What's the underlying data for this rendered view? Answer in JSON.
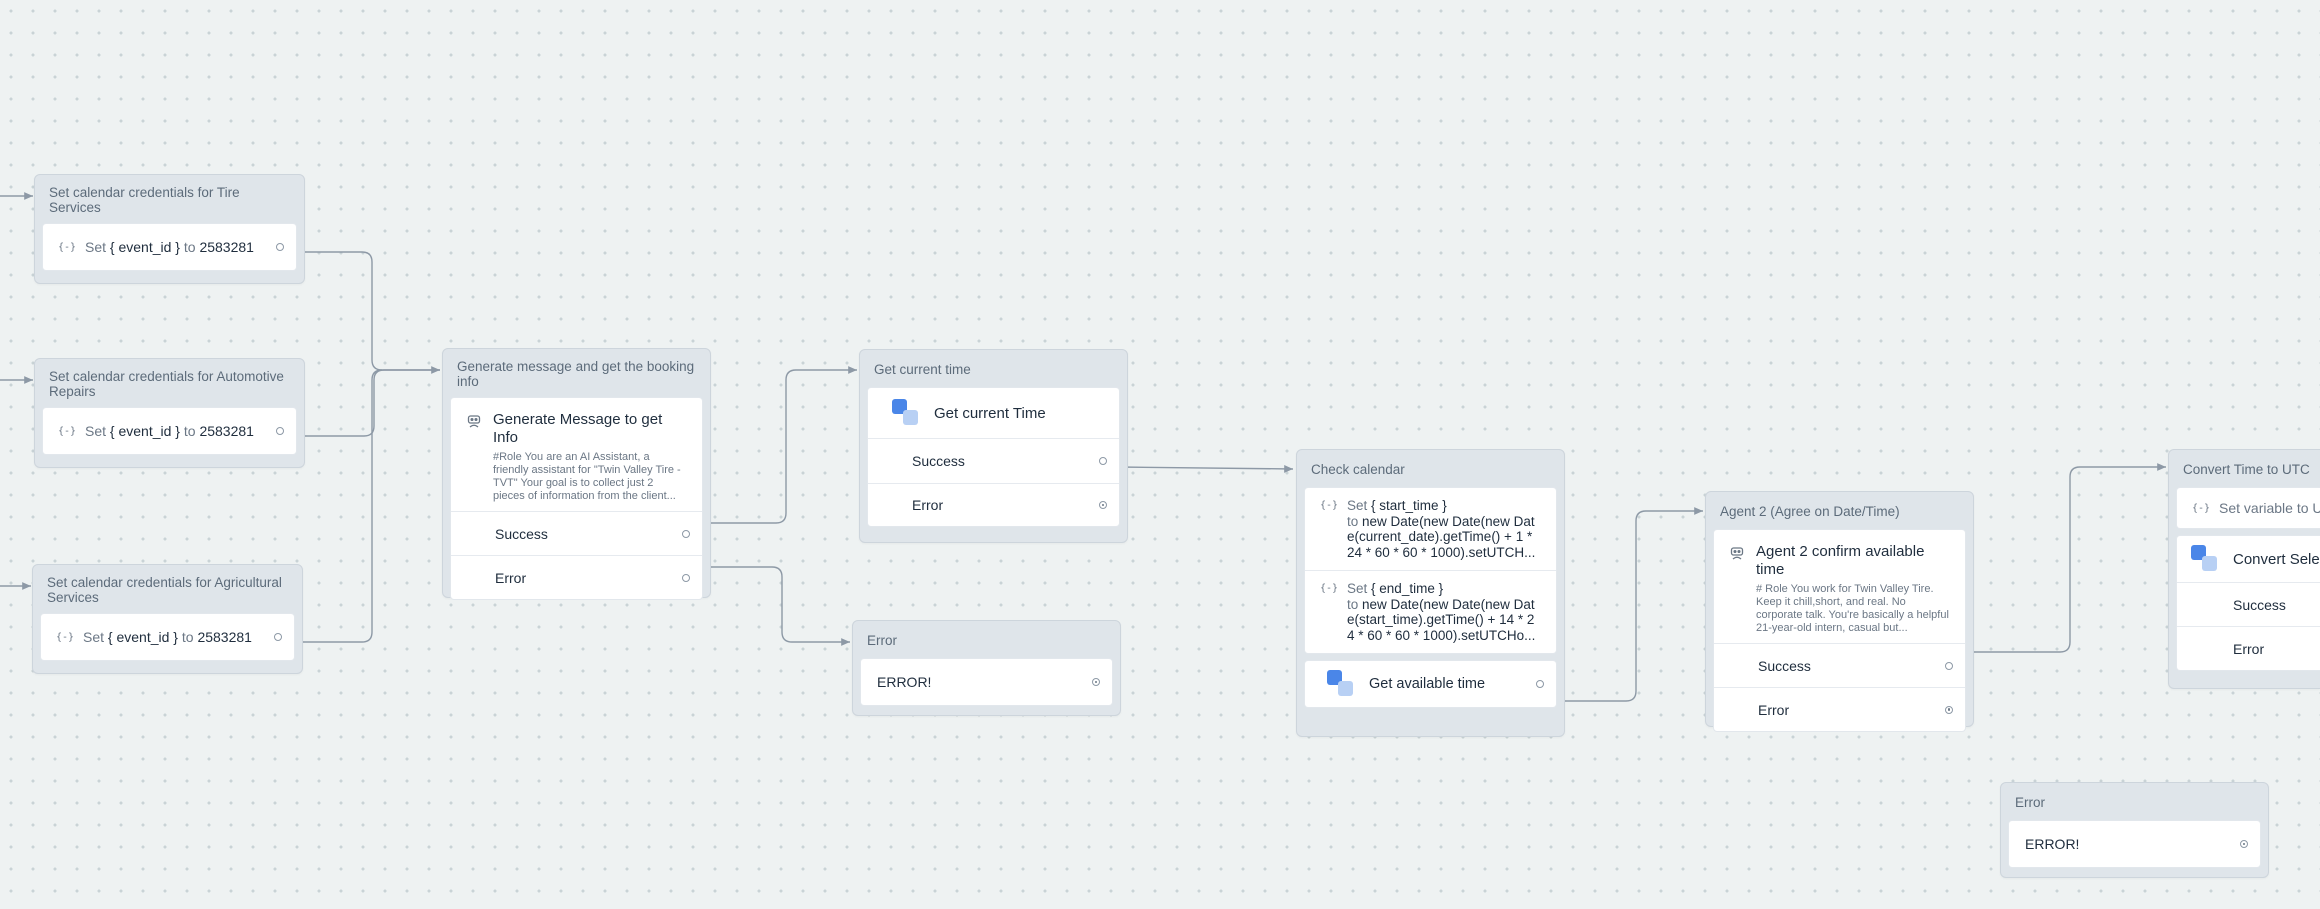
{
  "nodes": {
    "tire": {
      "title": "Set calendar credentials for Tire Services",
      "set_prefix": "Set",
      "variable": "{ event_id }",
      "to": "to",
      "value": "2583281",
      "icon": "variable-icon"
    },
    "auto": {
      "title": "Set calendar credentials for Automotive Repairs",
      "set_prefix": "Set",
      "variable": "{ event_id }",
      "to": "to",
      "value": "2583281",
      "icon": "variable-icon"
    },
    "agri": {
      "title": "Set calendar credentials for Agricultural Services",
      "set_prefix": "Set",
      "variable": "{ event_id }",
      "to": "to",
      "value": "2583281",
      "icon": "variable-icon"
    },
    "generate": {
      "title": "Generate message and get the booking info",
      "card_title": "Generate Message to get Info",
      "description": "#Role You are an AI Assistant, a friendly assistant for \"Twin Valley Tire - TVT\" Your goal is to collect just 2 pieces of information from the client...",
      "success": "Success",
      "error": "Error",
      "icon": "agent-icon"
    },
    "current_time": {
      "title": "Get current time",
      "card_title": "Get current Time",
      "success": "Success",
      "error": "Error",
      "icon": "api-icon"
    },
    "error1": {
      "title": "Error",
      "text": "ERROR!"
    },
    "check_calendar": {
      "title": "Check calendar",
      "set1_prefix": "Set",
      "set1_var": "{ start_time }",
      "set1_to": "to",
      "set1_value": "new Date(new Date(new Date(current_date).getTime() + 1 * 24 * 60 * 60 * 1000).setUTCH...",
      "set2_prefix": "Set",
      "set2_var": "{ end_time }",
      "set2_to": "to",
      "set2_value": "new Date(new Date(new Date(start_time).getTime() + 14 * 24 * 60 * 60 * 1000).setUTCHo...",
      "api_title": "Get available time"
    },
    "agent2": {
      "title": "Agent 2 (Agree on Date/Time)",
      "card_title": "Agent 2 confirm available time",
      "description": "# Role You work for Twin Valley Tire. Keep it chill,short, and real. No corporate talk. You're basically a helpful 21-year-old intern, casual but...",
      "success": "Success",
      "error": "Error"
    },
    "error2": {
      "title": "Error",
      "text": "ERROR!"
    },
    "convert": {
      "title": "Convert Time to UTC",
      "set_text": "Set variable to U",
      "api_title": "Convert Selec",
      "success": "Success",
      "error": "Error"
    }
  },
  "colors": {
    "canvas": "#eef2f2",
    "group": "#dfe5ea",
    "connector": "#8d99a6",
    "api_primary": "#4a86e8",
    "api_secondary": "#b8d0f4"
  }
}
